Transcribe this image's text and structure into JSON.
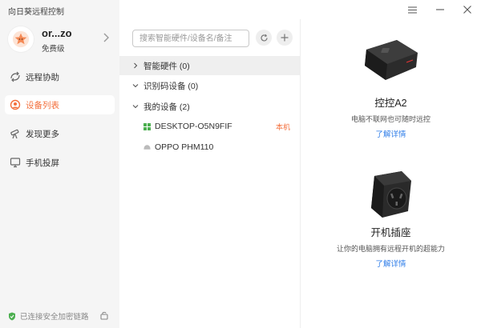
{
  "app": {
    "title": "向日葵远程控制"
  },
  "user": {
    "name": "or...zo",
    "level": "免费级"
  },
  "nav": {
    "remote": "远程协助",
    "devices": "设备列表",
    "discover": "发现更多",
    "cast": "手机投屏"
  },
  "footer": {
    "security": "已连接安全加密链路"
  },
  "search": {
    "placeholder": "搜索智能硬件/设备名/备注"
  },
  "groups": {
    "smart": "智能硬件 (0)",
    "id": "识别码设备 (0)",
    "mine": "我的设备 (2)"
  },
  "devices": [
    {
      "name": "DESKTOP-O5N9FIF",
      "badge": "本机",
      "status_color": "#4caf50"
    },
    {
      "name": "OPPO PHM110",
      "status_color": "#bbbbbb"
    }
  ],
  "products": [
    {
      "name": "控控A2",
      "desc": "电脑不联网也可随时远控",
      "link": "了解详情"
    },
    {
      "name": "开机插座",
      "desc": "让你的电脑拥有远程开机的超能力",
      "link": "了解详情"
    }
  ],
  "colors": {
    "accent": "#f36f3c",
    "link": "#2d7ce8",
    "sidebar_bg": "#f5f5f5"
  }
}
